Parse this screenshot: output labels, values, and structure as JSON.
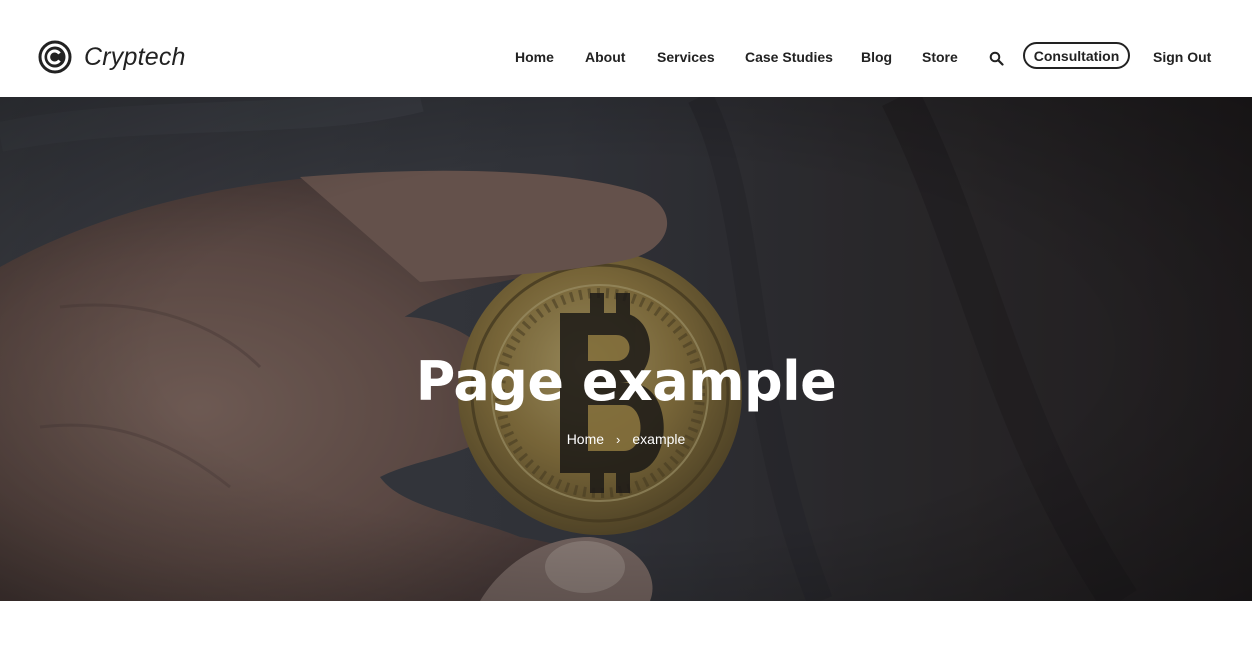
{
  "header": {
    "logo_text": "Cryptech",
    "logo_icon": "circle-c-logo-icon",
    "nav": [
      {
        "label": "Home"
      },
      {
        "label": "About"
      },
      {
        "label": "Services"
      },
      {
        "label": "Case Studies"
      },
      {
        "label": "Blog"
      },
      {
        "label": "Store"
      }
    ],
    "search_icon": "search-icon",
    "consultation_label": "Consultation",
    "signout_label": "Sign Out"
  },
  "hero": {
    "title": "Page example",
    "breadcrumb": {
      "home": "Home",
      "separator": "›",
      "current": "example"
    }
  },
  "colors": {
    "text_dark": "#222222",
    "hero_overlay": "#2b2b2e",
    "white": "#ffffff",
    "coin_gold": "#b99a4a"
  }
}
